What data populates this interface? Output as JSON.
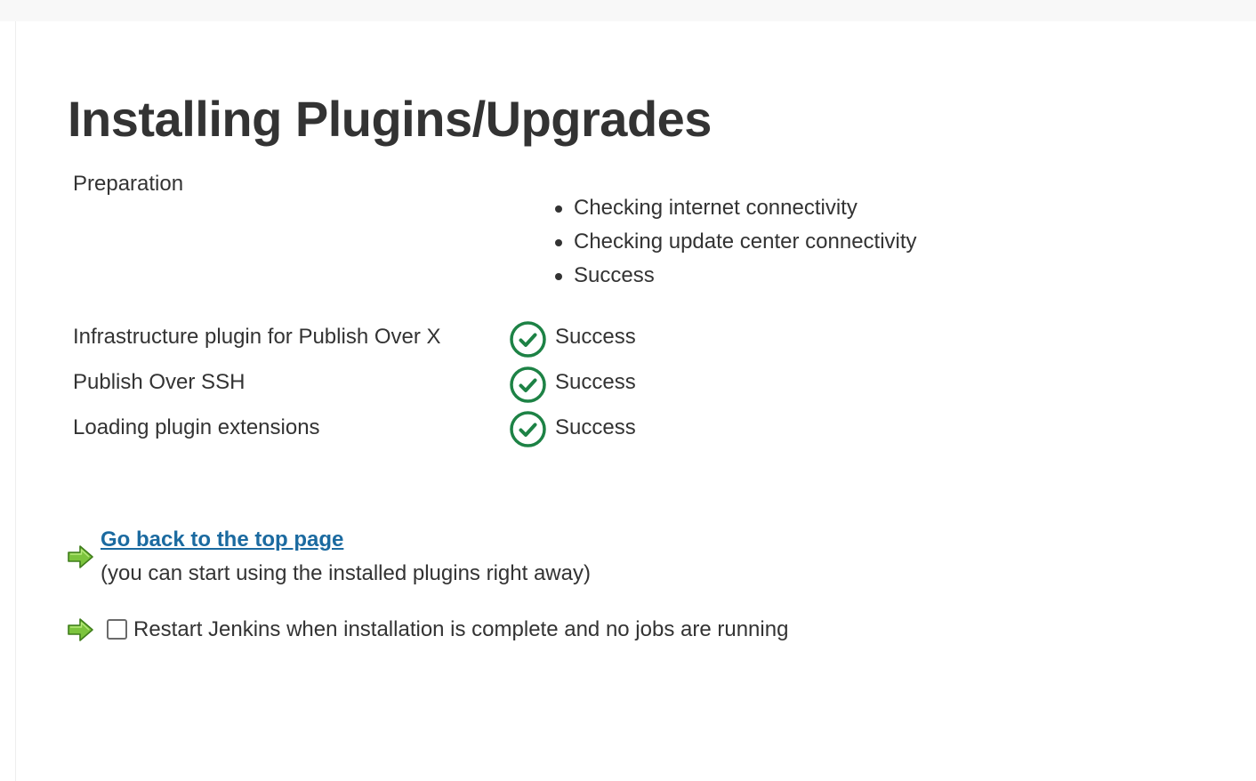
{
  "page": {
    "title": "Installing Plugins/Upgrades"
  },
  "preparation": {
    "label": "Preparation",
    "steps": [
      "Checking internet connectivity",
      "Checking update center connectivity",
      "Success"
    ]
  },
  "jobs": [
    {
      "name": "Infrastructure plugin for Publish Over X",
      "status": "Success",
      "icon": "success-check-icon"
    },
    {
      "name": "Publish Over SSH",
      "status": "Success",
      "icon": "success-check-icon"
    },
    {
      "name": "Loading plugin extensions",
      "status": "Success",
      "icon": "success-check-icon"
    }
  ],
  "footer": {
    "back_link": "Go back to the top page",
    "back_hint": "(you can start using the installed plugins right away)",
    "restart_label": "Restart Jenkins when installation is complete and no jobs are running",
    "restart_checked": false,
    "arrow_icon": "green-right-arrow-icon"
  },
  "colors": {
    "success": "#1d8245",
    "link": "#1b6aa0",
    "arrow": "#5cab2a"
  }
}
